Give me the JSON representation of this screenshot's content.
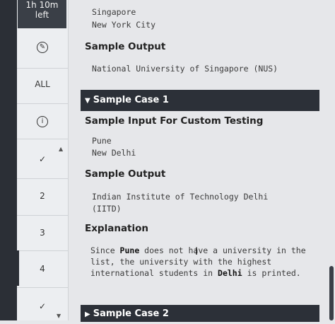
{
  "timer": {
    "line1": "1h 10m",
    "line2": "left"
  },
  "nav": {
    "all_label": "ALL",
    "items": [
      "2",
      "3",
      "4"
    ]
  },
  "content": {
    "input_lines": [
      "Singapore",
      "New York City"
    ],
    "sample_output_heading": "Sample Output",
    "sample_output_0": "National University of Singapore (NUS)",
    "case1_label": "Sample Case 1",
    "custom_input_heading": "Sample Input For Custom Testing",
    "case1_input": [
      "Pune",
      "New Delhi"
    ],
    "case1_output_heading": "Sample Output",
    "case1_output": [
      "Indian Institute of Technology Delhi",
      "(IITD)"
    ],
    "explanation_heading": "Explanation",
    "explanation": {
      "p1": "Since ",
      "city1": "Pune",
      "p2": " does not have a university in the list, the university with the highest international students in ",
      "city2": "Delhi",
      "p3": " is printed."
    },
    "case2_label": "Sample Case 2"
  }
}
